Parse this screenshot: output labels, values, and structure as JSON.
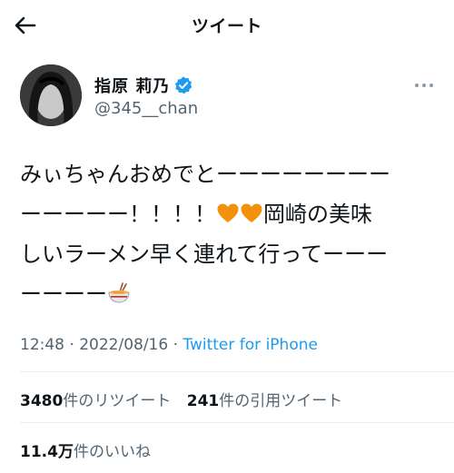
{
  "header": {
    "title": "ツイート",
    "back_icon": "arrow-left-icon"
  },
  "author": {
    "display_name": "指原 莉乃",
    "handle": "@345__chan",
    "verified_icon": "verified-badge-icon",
    "more_icon": "more-dots-icon"
  },
  "tweet": {
    "lines": [
      "みぃちゃんおめでとーーーーーーーー",
      "ーーーーー！！！！",
      "岡崎の美味",
      "しいラーメン早く連れて行ってーーー",
      "ーーーー"
    ],
    "emoji": [
      "orange-heart-icon",
      "orange-heart-icon",
      "ramen-bowl-icon"
    ]
  },
  "meta": {
    "time": "12:48 · 2022/08/16 · ",
    "source": "Twitter for iPhone"
  },
  "stats": {
    "retweets_count": "3480",
    "retweets_label": "件のリツイート",
    "quotes_count": "241",
    "quotes_label": "件の引用ツイート",
    "likes_count": "11.4万",
    "likes_label": "件のいいね"
  },
  "colors": {
    "link": "#1d9bf0",
    "secondary_text": "#536471",
    "verified": "#1d9bf0",
    "heart": "#f4900c"
  }
}
